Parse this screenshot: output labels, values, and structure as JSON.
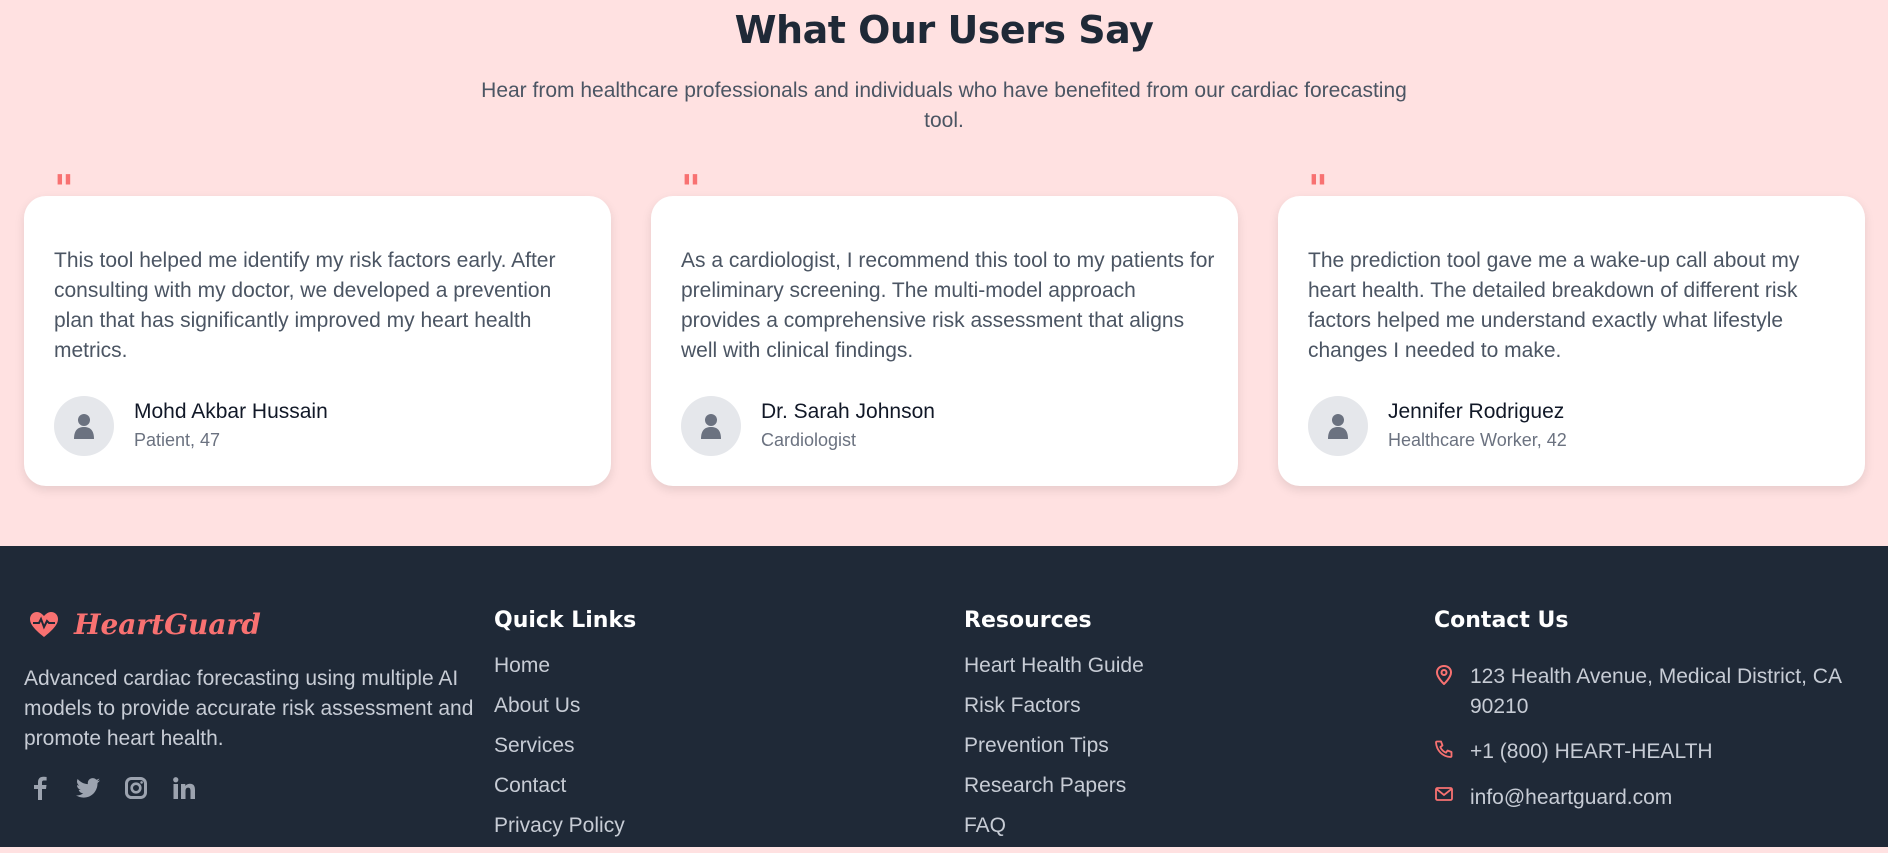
{
  "testimonials": {
    "title": "What Our Users Say",
    "subtitle": "Hear from healthcare professionals and individuals who have benefited from our cardiac forecasting tool.",
    "cards": [
      {
        "quote_mark": "\"",
        "text": "This tool helped me identify my risk factors early. After consulting with my doctor, we developed a prevention plan that has significantly improved my heart health metrics.",
        "name": "Mohd Akbar Hussain",
        "role": "Patient, 47",
        "avatar_icon": "user-icon"
      },
      {
        "quote_mark": "\"",
        "text": "As a cardiologist, I recommend this tool to my patients for preliminary screening. The multi-model approach provides a comprehensive risk assessment that aligns well with clinical findings.",
        "name": "Dr. Sarah Johnson",
        "role": "Cardiologist",
        "avatar_icon": "user-icon"
      },
      {
        "quote_mark": "\"",
        "text": "The prediction tool gave me a wake-up call about my heart health. The detailed breakdown of different risk factors helped me understand exactly what lifestyle changes I needed to make.",
        "name": "Jennifer Rodriguez",
        "role": "Healthcare Worker, 42",
        "avatar_icon": "user-icon"
      }
    ]
  },
  "footer": {
    "brand": "HeartGuard",
    "brand_icon": "heart-pulse-icon",
    "description": "Advanced cardiac forecasting using multiple AI models to provide accurate risk assessment and promote heart health.",
    "socials": [
      "facebook-icon",
      "twitter-icon",
      "instagram-icon",
      "linkedin-icon"
    ],
    "quick_links": {
      "title": "Quick Links",
      "items": [
        "Home",
        "About Us",
        "Services",
        "Contact",
        "Privacy Policy"
      ]
    },
    "resources": {
      "title": "Resources",
      "items": [
        "Heart Health Guide",
        "Risk Factors",
        "Prevention Tips",
        "Research Papers",
        "FAQ"
      ]
    },
    "contact": {
      "title": "Contact Us",
      "address": "123 Health Avenue, Medical District, CA 90210",
      "phone": "+1 (800) HEART-HEALTH",
      "email": "info@heartguard.com"
    }
  },
  "colors": {
    "accent": "#f87171",
    "section_bg": "#ffe1e1",
    "footer_bg": "#1f2937"
  }
}
